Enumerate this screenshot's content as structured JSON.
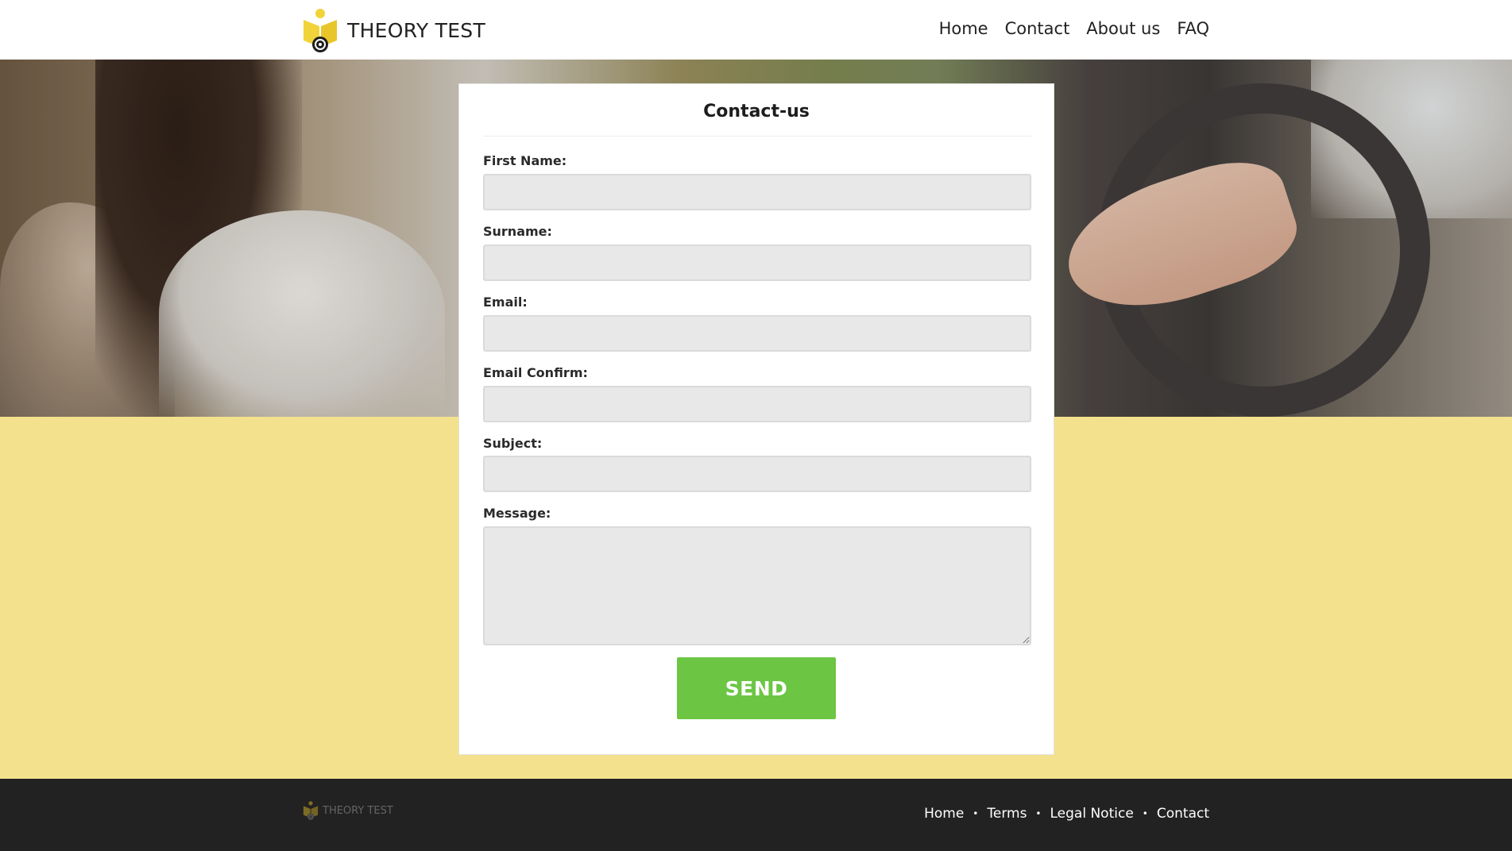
{
  "brand": {
    "name": "THEORY TEST",
    "accent_color": "#f1d33a",
    "icon": "book-steering-wheel-icon"
  },
  "header": {
    "nav": [
      {
        "label": "Home"
      },
      {
        "label": "Contact"
      },
      {
        "label": "About us"
      },
      {
        "label": "FAQ"
      }
    ]
  },
  "hero": {
    "image": "woman-driving-car-photo"
  },
  "form": {
    "title": "Contact-us",
    "fields": [
      {
        "label": "First Name:",
        "value": ""
      },
      {
        "label": "Surname:",
        "value": ""
      },
      {
        "label": "Email:",
        "value": ""
      },
      {
        "label": "Email Confirm:",
        "value": ""
      },
      {
        "label": "Subject:",
        "value": ""
      },
      {
        "label": "Message:",
        "value": ""
      }
    ],
    "submit_label": "SEND",
    "submit_color": "#6cc644"
  },
  "footer": {
    "brand_name": "THEORY TEST",
    "links": [
      {
        "label": "Home"
      },
      {
        "label": "Terms"
      },
      {
        "label": "Legal Notice"
      },
      {
        "label": "Contact"
      }
    ],
    "separator": "•"
  },
  "colors": {
    "page_background": "#f3e18d",
    "footer_background": "#222222",
    "input_background": "#e8e8e8"
  }
}
